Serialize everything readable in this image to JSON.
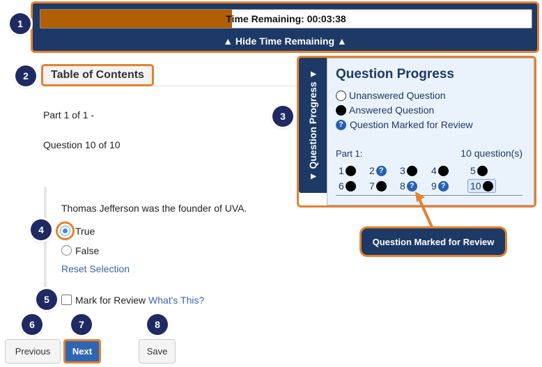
{
  "timer": {
    "label": "Time Remaining: 00:03:38",
    "progress_fraction": 0.39,
    "hide_label": "▲ Hide Time Remaining ▲"
  },
  "toc": {
    "label": "Table of Contents"
  },
  "part_heading": "Part 1 of 1 -",
  "question_heading": "Question 10 of 10",
  "question": {
    "text": "Thomas Jefferson was the founder of UVA.",
    "options": [
      {
        "label": "True",
        "selected": true
      },
      {
        "label": "False",
        "selected": false
      }
    ],
    "reset_label": "Reset Selection"
  },
  "mark_review": {
    "label": "Mark for Review",
    "link": "What's This?",
    "checked": false
  },
  "buttons": {
    "previous": "Previous",
    "next": "Next",
    "save": "Save"
  },
  "progress_panel": {
    "tab_label": "▼ Question Progress ▼",
    "title": "Question Progress",
    "legend": {
      "unanswered": "Unanswered Question",
      "answered": "Answered Question",
      "marked": "Question Marked for Review"
    },
    "part_label": "Part 1:",
    "count_label": "10 question(s)",
    "questions": [
      {
        "num": "1",
        "status": "answered"
      },
      {
        "num": "2",
        "status": "marked"
      },
      {
        "num": "3",
        "status": "answered"
      },
      {
        "num": "4",
        "status": "answered"
      },
      {
        "num": "5",
        "status": "answered"
      },
      {
        "num": "6",
        "status": "answered"
      },
      {
        "num": "7",
        "status": "answered"
      },
      {
        "num": "8",
        "status": "marked"
      },
      {
        "num": "9",
        "status": "marked"
      },
      {
        "num": "10",
        "status": "answered",
        "current": true
      }
    ]
  },
  "tooltip": "Question Marked for Review",
  "badges": [
    "1",
    "2",
    "3",
    "4",
    "5",
    "6",
    "7",
    "8"
  ],
  "colors": {
    "navy": "#1d3966",
    "highlight_orange": "#e4812f",
    "timer_fill": "#b05f06",
    "primary_button": "#2f66b3",
    "marked_icon": "#2660b4"
  }
}
